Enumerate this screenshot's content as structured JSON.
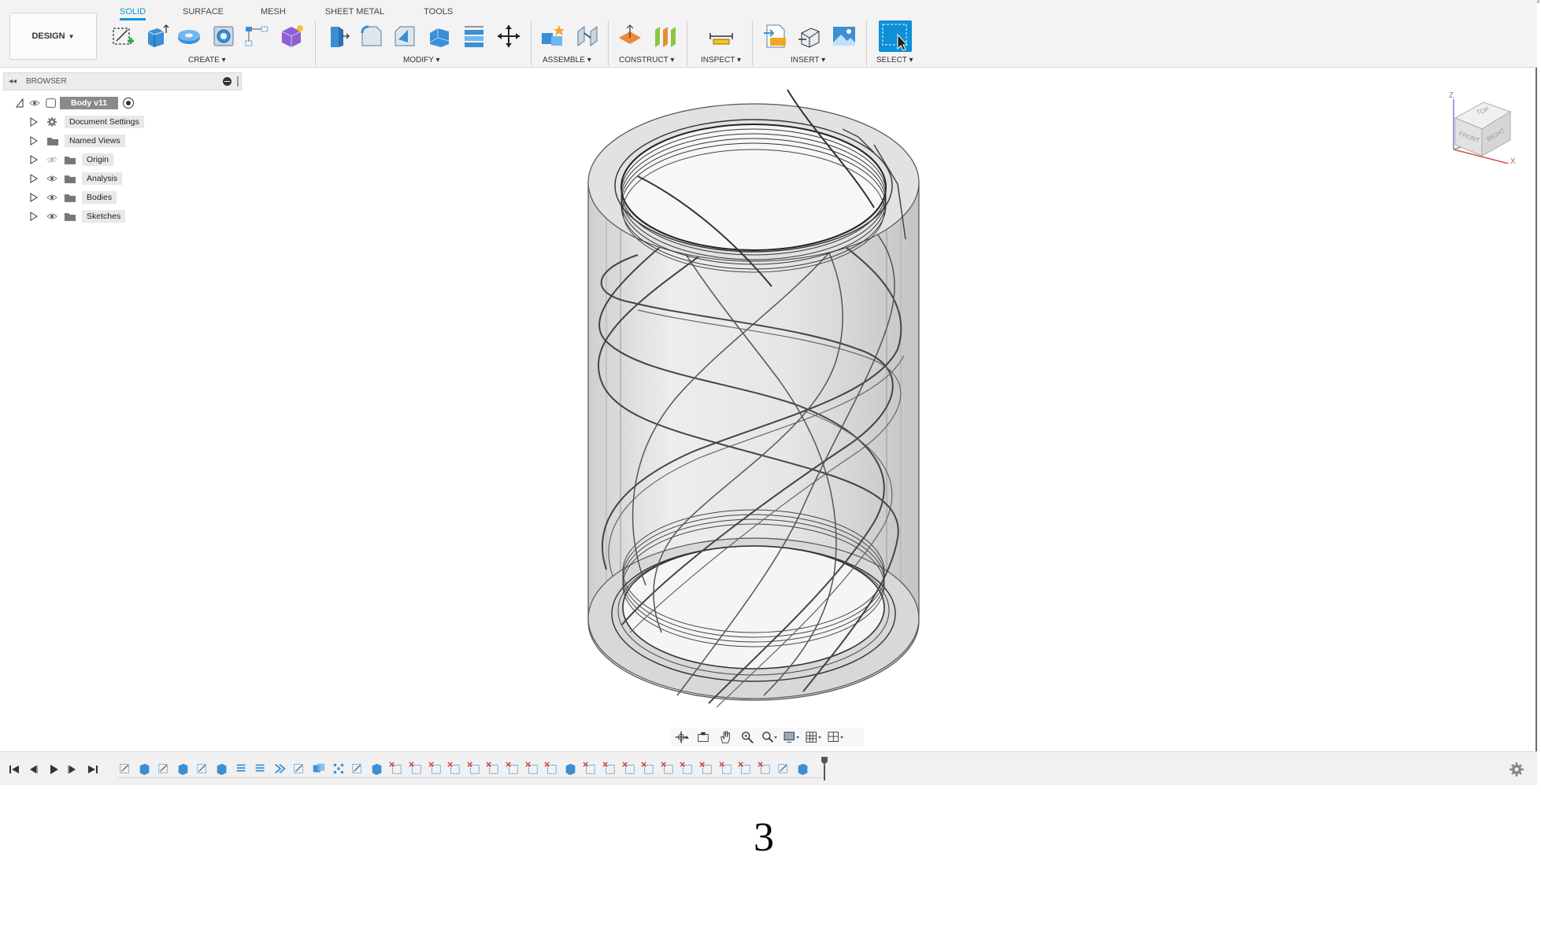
{
  "toolbar": {
    "workspace_label": "DESIGN",
    "tabs": [
      {
        "label": "SOLID",
        "active": true
      },
      {
        "label": "SURFACE",
        "active": false
      },
      {
        "label": "MESH",
        "active": false
      },
      {
        "label": "SHEET METAL",
        "active": false
      },
      {
        "label": "TOOLS",
        "active": false
      }
    ],
    "groups": {
      "create": "CREATE ▾",
      "modify": "MODIFY ▾",
      "assemble": "ASSEMBLE ▾",
      "construct": "CONSTRUCT ▾",
      "inspect": "INSPECT ▾",
      "insert": "INSERT ▾",
      "select": "SELECT ▾"
    },
    "accent_color": "#0696d7"
  },
  "browser": {
    "title": "BROWSER",
    "root": {
      "label": "Body v11"
    },
    "items": [
      {
        "label": "Document Settings",
        "icon": "gear-icon"
      },
      {
        "label": "Named Views",
        "icon": "folder-icon"
      },
      {
        "label": "Origin",
        "icon": "folder-icon"
      },
      {
        "label": "Analysis",
        "icon": "folder-icon"
      },
      {
        "label": "Bodies",
        "icon": "folder-icon"
      },
      {
        "label": "Sketches",
        "icon": "folder-icon"
      }
    ]
  },
  "viewcube": {
    "faces": [
      "TOP",
      "FRONT",
      "RIGHT"
    ],
    "axes": [
      "Z",
      "X"
    ]
  },
  "page_number": "3"
}
